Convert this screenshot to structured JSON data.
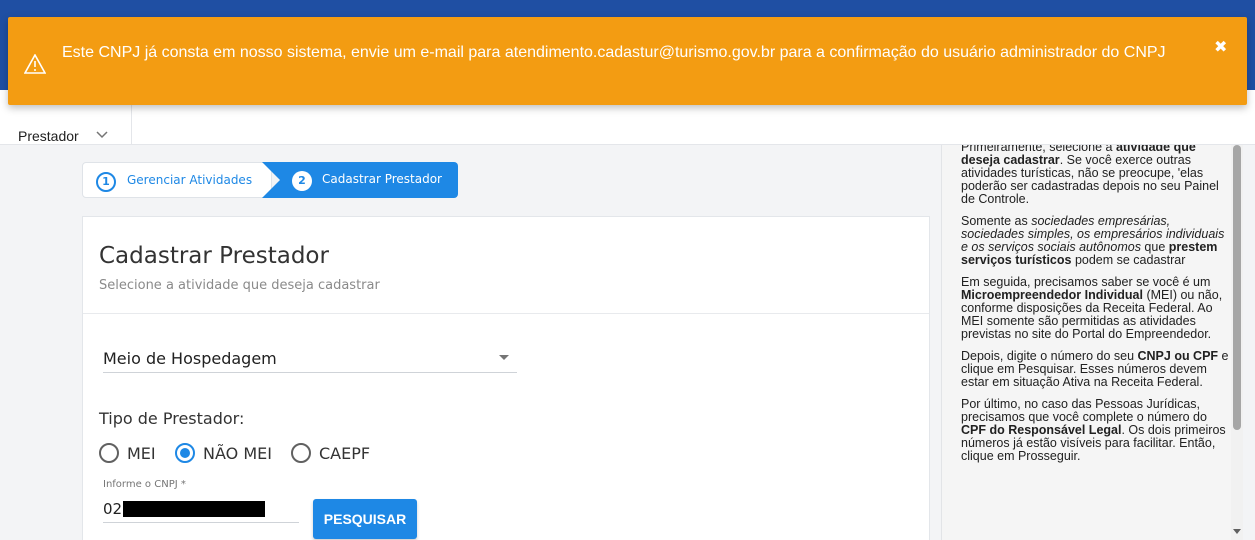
{
  "alert": {
    "message": "Este CNPJ já consta em nosso sistema, envie um e-mail para atendimento.cadastur@turismo.gov.br para a confirmação do usuário administrador do CNPJ",
    "close_glyph": "✖",
    "icon": "warning-icon"
  },
  "nav": {
    "menu_label": "Prestador",
    "icon": "chevron-down-icon"
  },
  "stepper": {
    "steps": [
      {
        "number": "1",
        "label": "Gerenciar Atividades"
      },
      {
        "number": "2",
        "label": "Cadastrar Prestador"
      }
    ]
  },
  "form": {
    "title": "Cadastrar Prestador",
    "subtitle": "Selecione a atividade que deseja cadastrar",
    "activity_select": {
      "value": "Meio de Hospedagem"
    },
    "tipo_label": "Tipo de Prestador:",
    "options": [
      {
        "label": "MEI",
        "checked": false
      },
      {
        "label": "NÃO MEI",
        "checked": true
      },
      {
        "label": "CAEPF",
        "checked": false
      }
    ],
    "cnpj_label": "Informe o CNPJ *",
    "cnpj_value": "02",
    "search_button": "PESQUISAR"
  },
  "colors": {
    "alert": "#f39c12",
    "primary": "#1e88e5",
    "header": "#1f4fa3"
  }
}
